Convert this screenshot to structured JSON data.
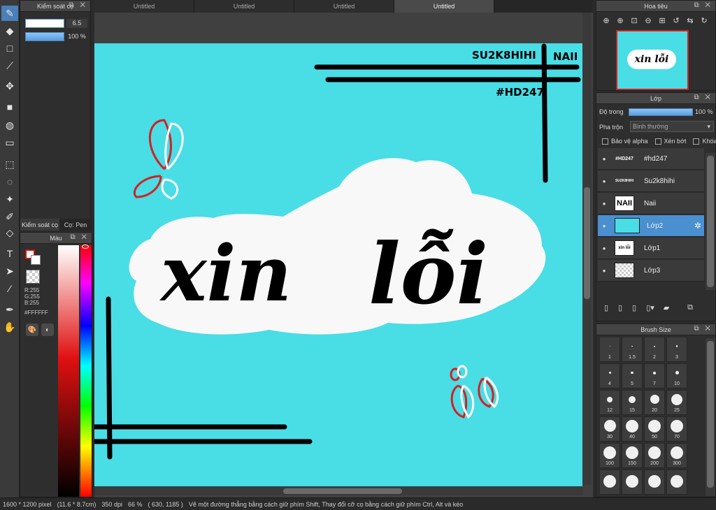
{
  "tabs": [
    "Untitled",
    "Untitled",
    "Untitled",
    "Untitled"
  ],
  "brush_control": {
    "title": "Kiểm soát cọ",
    "size_value": "6.5",
    "opacity_value": "100 %",
    "tab_control": "Kiểm soát cọ",
    "tab_pen": "Cọ: Pen"
  },
  "color_panel": {
    "title": "Màu",
    "r": "R:255",
    "g": "G:255",
    "b": "B:255",
    "hex": "#FFFFFF"
  },
  "navigator": {
    "title": "Hoa tiêu"
  },
  "layers_panel": {
    "title": "Lớp",
    "opacity_label": "Độ trong",
    "opacity_value": "100 %",
    "blend_label": "Pha trộn",
    "blend_value": "Bình thường",
    "protect_alpha": "Bảo vệ alpha",
    "clipping": "Xén bớt",
    "lock": "Khóa",
    "layers": [
      {
        "name": "#hd247",
        "thumb": "#HD247"
      },
      {
        "name": "Su2k8hihi",
        "thumb": "SU2K8HIHI"
      },
      {
        "name": "Naii",
        "thumb": "NAII"
      },
      {
        "name": "Lớp2",
        "thumb": ""
      },
      {
        "name": "Lớp1",
        "thumb": "xin lỗi"
      },
      {
        "name": "Lớp3",
        "thumb": ""
      }
    ]
  },
  "brush_size": {
    "title": "Brush Size",
    "sizes": [
      {
        "label": "1",
        "d": 1
      },
      {
        "label": "1.5",
        "d": 1.5
      },
      {
        "label": "2",
        "d": 2
      },
      {
        "label": "3",
        "d": 2.5
      },
      {
        "label": "4",
        "d": 3
      },
      {
        "label": "5",
        "d": 3.5
      },
      {
        "label": "7",
        "d": 4
      },
      {
        "label": "10",
        "d": 5
      },
      {
        "label": "12",
        "d": 8
      },
      {
        "label": "15",
        "d": 10
      },
      {
        "label": "20",
        "d": 13
      },
      {
        "label": "25",
        "d": 16
      },
      {
        "label": "30",
        "d": 17
      },
      {
        "label": "40",
        "d": 18
      },
      {
        "label": "50",
        "d": 18
      },
      {
        "label": "70",
        "d": 18
      },
      {
        "label": "100",
        "d": 18
      },
      {
        "label": "150",
        "d": 18
      },
      {
        "label": "200",
        "d": 18
      },
      {
        "label": "300",
        "d": 18
      },
      {
        "label": "",
        "d": 18
      },
      {
        "label": "",
        "d": 18
      },
      {
        "label": "",
        "d": 18
      },
      {
        "label": "",
        "d": 18
      }
    ]
  },
  "canvas": {
    "background_color": "#49dde6",
    "text_main_1": "xin",
    "text_main_2": "lỗi",
    "text_su2k8": "SU2K8HIHI",
    "text_naii": "NAII",
    "text_hd": "#HD247"
  },
  "status": {
    "pixel_size": "1600 * 1200 pixel",
    "cm_size": "(11.6 * 8.7cm)",
    "dpi": "350 dpi",
    "zoom": "66 %",
    "coords": "( 630, 1185 )",
    "hint": "Vẽ một đường thẳng bằng cách giữ phím Shift, Thay đổi cỡ cọ bằng cách giữ phím Ctrl, Alt và kéo"
  },
  "colors": {
    "accent": "#4a8fd0",
    "canvas_cyan": "#49dde6",
    "heart_red": "#d42020"
  }
}
